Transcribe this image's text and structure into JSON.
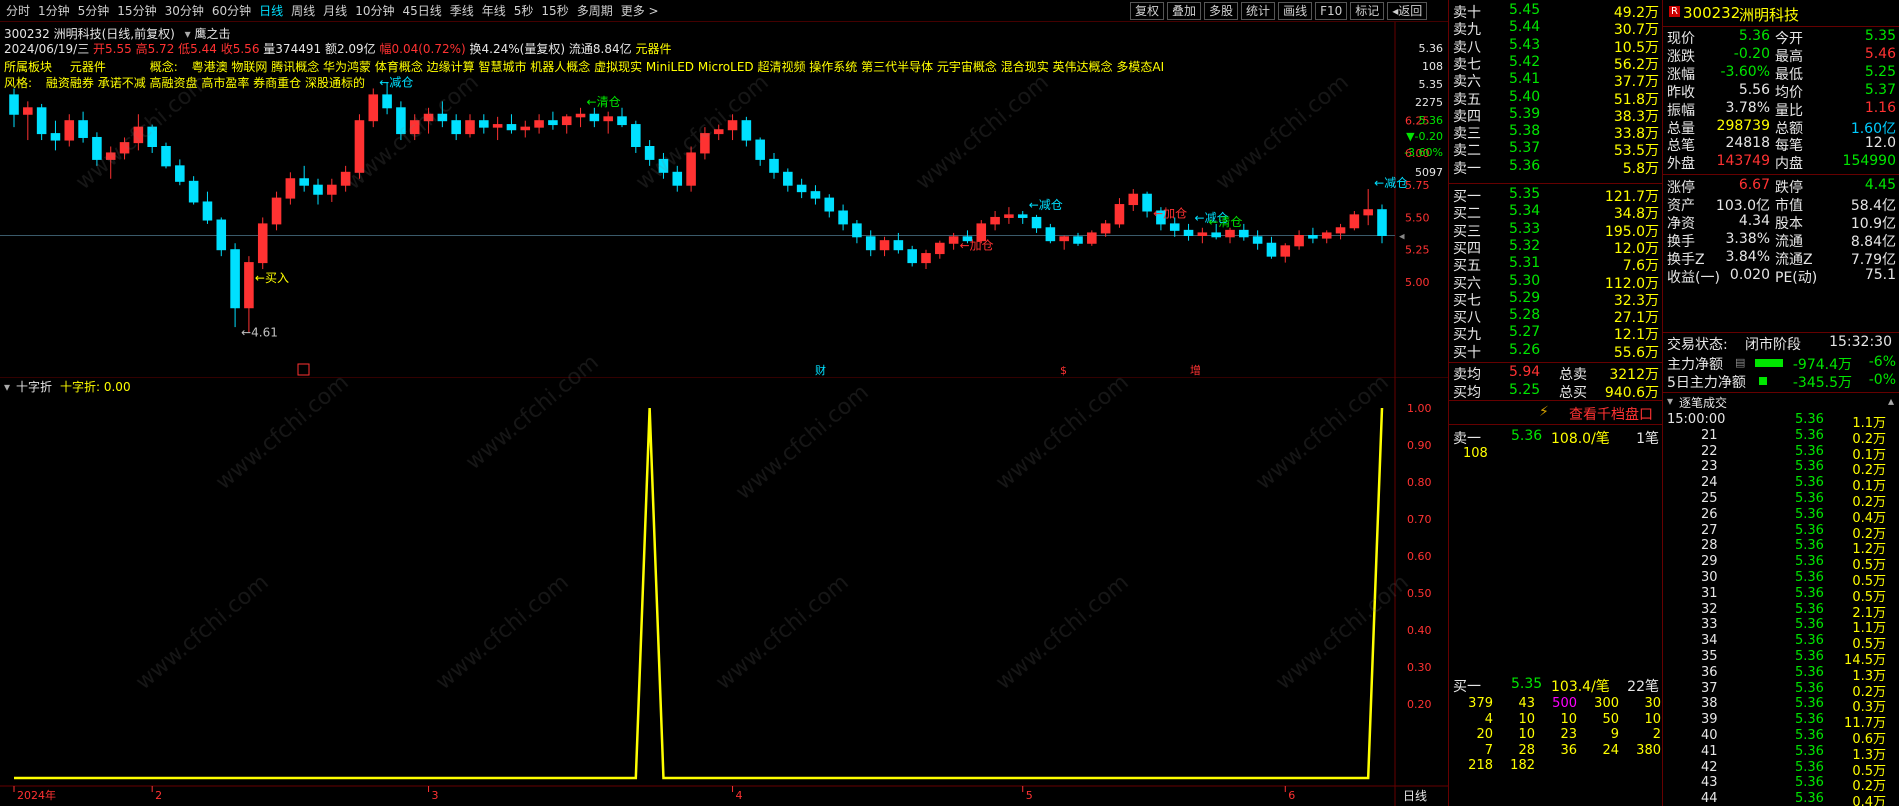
{
  "toolbar": {
    "timeframes": [
      "分时",
      "1分钟",
      "5分钟",
      "15分钟",
      "30分钟",
      "60分钟",
      "日线",
      "周线",
      "月线",
      "10分钟",
      "45日线",
      "季线",
      "年线",
      "5秒",
      "15秒",
      "多周期",
      "更多 >"
    ],
    "active_timeframe": "日线",
    "buttons": [
      "复权",
      "叠加",
      "多股",
      "统计",
      "画线",
      "F10",
      "标记",
      "◂返回"
    ]
  },
  "chart_header": {
    "title": "300232 洲明科技(日线,前复权)",
    "indicator": "鹰之击",
    "info_date": "2024/06/19/三",
    "info_open": "开5.55",
    "info_high": "高5.72",
    "info_low": "低5.44",
    "info_close": "收5.56",
    "info_vol": "量374491",
    "info_amt": "额2.09亿",
    "info_chg": "幅0.04(0.72%)",
    "info_turn": "换4.24%(量复权)",
    "info_float": "流通8.84亿",
    "info_sector": "元器件",
    "sector_label": "所属板块",
    "sector_value": "元器件",
    "concept_label": "概念:",
    "concepts": "粤港澳 物联网 腾讯概念 华为鸿蒙 体育概念 边缘计算 智慧城市 机器人概念 虚拟现实 MiniLED MicroLED 超清视频 操作系统 第三代半导体 元宇宙概念 混合现实 英伟达概念 多模态AI",
    "style_label": "风格:",
    "styles": "融资融券 承诺不减 高融资盘 高市盈率 券商重仓 深股通标的"
  },
  "annotations": [
    {
      "text": "←减仓",
      "color": "#00e0ff"
    },
    {
      "text": "←清仓",
      "color": "#00e600"
    },
    {
      "text": "←买入",
      "color": "#ffff00"
    },
    {
      "text": "←4.61",
      "color": "#c0c0c0"
    },
    {
      "text": "←加仓",
      "color": "#ff3232"
    },
    {
      "text": "←减仓",
      "color": "#00e0ff"
    },
    {
      "text": "←减仓",
      "color": "#00e0ff"
    },
    {
      "text": "←清仓",
      "color": "#00e600"
    },
    {
      "text": "←加仓",
      "color": "#ff3232"
    },
    {
      "text": "←减仓",
      "color": "#00e0ff"
    }
  ],
  "markers": [
    "财",
    "$",
    "增"
  ],
  "price_axis": [
    "6.25",
    "6.00",
    "5.75",
    "5.50",
    "5.25",
    "5.00"
  ],
  "price_axis_info": [
    "5.36",
    "108",
    "5.35",
    "2275",
    "5.36",
    "▼-0.20",
    "-3.60%",
    "5097"
  ],
  "indicator_panel": {
    "name": "十字折",
    "value_label": "十字折: 0.00",
    "axis": [
      "1.00",
      "0.90",
      "0.80",
      "0.70",
      "0.60",
      "0.50",
      "0.40",
      "0.30",
      "0.20"
    ]
  },
  "x_axis": [
    "2024年",
    "2",
    "3",
    "4",
    "5",
    "6"
  ],
  "period_label": "日线",
  "chart_data": {
    "type": "candlestick",
    "ylim": [
      4.55,
      6.55
    ],
    "ohlc": [
      [
        6.45,
        6.5,
        6.2,
        6.3
      ],
      [
        6.3,
        6.4,
        6.1,
        6.35
      ],
      [
        6.35,
        6.38,
        6.1,
        6.15
      ],
      [
        6.15,
        6.25,
        6.02,
        6.1
      ],
      [
        6.1,
        6.3,
        6.05,
        6.25
      ],
      [
        6.25,
        6.32,
        6.08,
        6.12
      ],
      [
        6.12,
        6.16,
        5.9,
        5.95
      ],
      [
        5.95,
        6.05,
        5.8,
        6.0
      ],
      [
        6.0,
        6.12,
        5.95,
        6.08
      ],
      [
        6.08,
        6.3,
        6.02,
        6.2
      ],
      [
        6.2,
        6.22,
        6.0,
        6.05
      ],
      [
        6.05,
        6.08,
        5.88,
        5.9
      ],
      [
        5.9,
        5.95,
        5.75,
        5.78
      ],
      [
        5.78,
        5.82,
        5.6,
        5.62
      ],
      [
        5.62,
        5.7,
        5.45,
        5.48
      ],
      [
        5.48,
        5.5,
        5.2,
        5.25
      ],
      [
        5.25,
        5.3,
        4.65,
        4.8
      ],
      [
        4.8,
        5.2,
        4.61,
        5.15
      ],
      [
        5.15,
        5.5,
        5.1,
        5.45
      ],
      [
        5.45,
        5.7,
        5.4,
        5.65
      ],
      [
        5.65,
        5.85,
        5.6,
        5.8
      ],
      [
        5.8,
        5.9,
        5.7,
        5.75
      ],
      [
        5.75,
        5.8,
        5.6,
        5.68
      ],
      [
        5.68,
        5.8,
        5.62,
        5.75
      ],
      [
        5.75,
        5.9,
        5.7,
        5.85
      ],
      [
        5.85,
        6.3,
        5.8,
        6.25
      ],
      [
        6.25,
        6.5,
        6.2,
        6.45
      ],
      [
        6.45,
        6.55,
        6.3,
        6.35
      ],
      [
        6.35,
        6.4,
        6.1,
        6.15
      ],
      [
        6.15,
        6.3,
        6.1,
        6.25
      ],
      [
        6.25,
        6.35,
        6.15,
        6.3
      ],
      [
        6.3,
        6.4,
        6.2,
        6.25
      ],
      [
        6.25,
        6.3,
        6.1,
        6.15
      ],
      [
        6.15,
        6.3,
        6.12,
        6.25
      ],
      [
        6.25,
        6.3,
        6.15,
        6.2
      ],
      [
        6.2,
        6.28,
        6.1,
        6.22
      ],
      [
        6.22,
        6.3,
        6.15,
        6.18
      ],
      [
        6.18,
        6.25,
        6.12,
        6.2
      ],
      [
        6.2,
        6.3,
        6.15,
        6.25
      ],
      [
        6.25,
        6.32,
        6.18,
        6.22
      ],
      [
        6.22,
        6.3,
        6.15,
        6.28
      ],
      [
        6.28,
        6.35,
        6.2,
        6.3
      ],
      [
        6.3,
        6.35,
        6.2,
        6.25
      ],
      [
        6.25,
        6.32,
        6.15,
        6.28
      ],
      [
        6.28,
        6.35,
        6.2,
        6.22
      ],
      [
        6.22,
        6.25,
        6.0,
        6.05
      ],
      [
        6.05,
        6.1,
        5.9,
        5.95
      ],
      [
        5.95,
        6.0,
        5.8,
        5.85
      ],
      [
        5.85,
        5.9,
        5.7,
        5.75
      ],
      [
        5.75,
        6.05,
        5.7,
        6.0
      ],
      [
        6.0,
        6.2,
        5.95,
        6.15
      ],
      [
        6.15,
        6.22,
        6.1,
        6.18
      ],
      [
        6.18,
        6.3,
        6.1,
        6.25
      ],
      [
        6.25,
        6.28,
        6.05,
        6.1
      ],
      [
        6.1,
        6.12,
        5.9,
        5.95
      ],
      [
        5.95,
        6.0,
        5.8,
        5.85
      ],
      [
        5.85,
        5.88,
        5.7,
        5.75
      ],
      [
        5.75,
        5.8,
        5.65,
        5.7
      ],
      [
        5.7,
        5.75,
        5.6,
        5.65
      ],
      [
        5.65,
        5.68,
        5.5,
        5.55
      ],
      [
        5.55,
        5.6,
        5.4,
        5.45
      ],
      [
        5.45,
        5.48,
        5.3,
        5.35
      ],
      [
        5.35,
        5.4,
        5.2,
        5.25
      ],
      [
        5.25,
        5.35,
        5.2,
        5.32
      ],
      [
        5.32,
        5.38,
        5.22,
        5.25
      ],
      [
        5.25,
        5.28,
        5.12,
        5.15
      ],
      [
        5.15,
        5.25,
        5.1,
        5.22
      ],
      [
        5.22,
        5.32,
        5.18,
        5.3
      ],
      [
        5.3,
        5.38,
        5.25,
        5.35
      ],
      [
        5.35,
        5.4,
        5.3,
        5.32
      ],
      [
        5.32,
        5.48,
        5.3,
        5.45
      ],
      [
        5.45,
        5.55,
        5.4,
        5.5
      ],
      [
        5.5,
        5.58,
        5.45,
        5.52
      ],
      [
        5.52,
        5.55,
        5.45,
        5.5
      ],
      [
        5.5,
        5.52,
        5.38,
        5.42
      ],
      [
        5.42,
        5.45,
        5.3,
        5.32
      ],
      [
        5.32,
        5.36,
        5.25,
        5.35
      ],
      [
        5.35,
        5.38,
        5.28,
        5.3
      ],
      [
        5.3,
        5.4,
        5.28,
        5.38
      ],
      [
        5.38,
        5.48,
        5.35,
        5.45
      ],
      [
        5.45,
        5.65,
        5.42,
        5.6
      ],
      [
        5.6,
        5.72,
        5.55,
        5.68
      ],
      [
        5.68,
        5.7,
        5.5,
        5.55
      ],
      [
        5.55,
        5.58,
        5.4,
        5.45
      ],
      [
        5.45,
        5.5,
        5.35,
        5.4
      ],
      [
        5.4,
        5.45,
        5.32,
        5.36
      ],
      [
        5.36,
        5.42,
        5.3,
        5.38
      ],
      [
        5.38,
        5.45,
        5.33,
        5.35
      ],
      [
        5.35,
        5.42,
        5.3,
        5.4
      ],
      [
        5.4,
        5.45,
        5.32,
        5.35
      ],
      [
        5.35,
        5.4,
        5.25,
        5.3
      ],
      [
        5.3,
        5.35,
        5.18,
        5.2
      ],
      [
        5.2,
        5.3,
        5.15,
        5.28
      ],
      [
        5.28,
        5.4,
        5.25,
        5.36
      ],
      [
        5.36,
        5.42,
        5.3,
        5.34
      ],
      [
        5.34,
        5.4,
        5.3,
        5.38
      ],
      [
        5.38,
        5.45,
        5.33,
        5.42
      ],
      [
        5.42,
        5.55,
        5.4,
        5.52
      ],
      [
        5.52,
        5.72,
        5.44,
        5.56
      ],
      [
        5.56,
        5.6,
        5.3,
        5.36
      ]
    ],
    "indicator_values_spikes": [
      {
        "index": 46,
        "value": 1.0
      },
      {
        "index": 99,
        "value": 1.0
      }
    ]
  },
  "order_book": {
    "sell": [
      {
        "label": "卖十",
        "price": "5.45",
        "vol": "49.2万"
      },
      {
        "label": "卖九",
        "price": "5.44",
        "vol": "30.7万"
      },
      {
        "label": "卖八",
        "price": "5.43",
        "vol": "10.5万"
      },
      {
        "label": "卖七",
        "price": "5.42",
        "vol": "56.2万"
      },
      {
        "label": "卖六",
        "price": "5.41",
        "vol": "37.7万"
      },
      {
        "label": "卖五",
        "price": "5.40",
        "vol": "51.8万"
      },
      {
        "label": "卖四",
        "price": "5.39",
        "vol": "38.3万"
      },
      {
        "label": "卖三",
        "price": "5.38",
        "vol": "33.8万"
      },
      {
        "label": "卖二",
        "price": "5.37",
        "vol": "53.5万"
      },
      {
        "label": "卖一",
        "price": "5.36",
        "vol": "5.8万"
      }
    ],
    "buy": [
      {
        "label": "买一",
        "price": "5.35",
        "vol": "121.7万"
      },
      {
        "label": "买二",
        "price": "5.34",
        "vol": "34.8万"
      },
      {
        "label": "买三",
        "price": "5.33",
        "vol": "195.0万"
      },
      {
        "label": "买四",
        "price": "5.32",
        "vol": "12.0万"
      },
      {
        "label": "买五",
        "price": "5.31",
        "vol": "7.6万"
      },
      {
        "label": "买六",
        "price": "5.30",
        "vol": "112.0万"
      },
      {
        "label": "买七",
        "price": "5.29",
        "vol": "32.3万"
      },
      {
        "label": "买八",
        "price": "5.28",
        "vol": "27.1万"
      },
      {
        "label": "买九",
        "price": "5.27",
        "vol": "12.1万"
      },
      {
        "label": "买十",
        "price": "5.26",
        "vol": "55.6万"
      }
    ],
    "avg_sell_label": "卖均",
    "avg_sell": "5.94",
    "total_sell_label": "总卖",
    "total_sell": "3212万",
    "avg_buy_label": "买均",
    "avg_buy": "5.25",
    "total_buy_label": "总买",
    "total_buy": "940.6万",
    "view_depth": "查看千档盘口",
    "sell1_detail": {
      "label": "卖一",
      "price": "5.36",
      "per": "108.0/笔",
      "count": "1笔",
      "orders": [
        "108"
      ]
    },
    "buy1_detail": {
      "label": "买一",
      "price": "5.35",
      "per": "103.4/笔",
      "count": "22笔",
      "orders": [
        [
          "379",
          "43",
          "500",
          "300",
          "30"
        ],
        [
          "4",
          "10",
          "10",
          "50",
          "10"
        ],
        [
          "20",
          "10",
          "23",
          "9",
          "2"
        ],
        [
          "7",
          "28",
          "36",
          "24",
          "380"
        ],
        [
          "218",
          "182",
          "",
          "",
          ""
        ]
      ]
    }
  },
  "quote": {
    "code": "300232",
    "name": "洲明科技",
    "tag": "R",
    "rows": [
      [
        "现价",
        "5.36",
        "今开",
        "5.35"
      ],
      [
        "涨跌",
        "-0.20",
        "最高",
        "5.46"
      ],
      [
        "涨幅",
        "-3.60%",
        "最低",
        "5.25"
      ],
      [
        "昨收",
        "5.56",
        "均价",
        "5.37"
      ],
      [
        "振幅",
        "3.78%",
        "量比",
        "1.16"
      ],
      [
        "总量",
        "298739",
        "总额",
        "1.60亿"
      ],
      [
        "总笔",
        "24818",
        "每笔",
        "12.0"
      ],
      [
        "外盘",
        "143749",
        "内盘",
        "154990"
      ],
      [
        "涨停",
        "6.67",
        "跌停",
        "4.45"
      ],
      [
        "资产",
        "103.0亿",
        "市值",
        "58.4亿"
      ],
      [
        "净资",
        "4.34",
        "股本",
        "10.9亿"
      ],
      [
        "换手",
        "3.38%",
        "流通",
        "8.84亿"
      ],
      [
        "换手Z",
        "3.84%",
        "流通Z",
        "7.79亿"
      ],
      [
        "收益(一)",
        "0.020",
        "PE(动)",
        "75.1"
      ]
    ],
    "trade_status_label": "交易状态:",
    "trade_status": "闭市阶段",
    "trade_time": "15:32:30",
    "mainflow_label": "主力净额",
    "mainflow": "-974.4万",
    "mainflow_pct": "-6%",
    "mainflow5_label": "5日主力净额",
    "mainflow5": "-345.5万",
    "mainflow5_pct": "-0%",
    "ticks_title": "逐笔成交",
    "ticks": [
      [
        "15:00:00",
        "5.36",
        "1.1万"
      ],
      [
        "21",
        "5.36",
        "0.2万"
      ],
      [
        "22",
        "5.36",
        "0.1万"
      ],
      [
        "23",
        "5.36",
        "0.2万"
      ],
      [
        "24",
        "5.36",
        "0.1万"
      ],
      [
        "25",
        "5.36",
        "0.2万"
      ],
      [
        "26",
        "5.36",
        "0.4万"
      ],
      [
        "27",
        "5.36",
        "0.2万"
      ],
      [
        "28",
        "5.36",
        "1.2万"
      ],
      [
        "29",
        "5.36",
        "0.5万"
      ],
      [
        "30",
        "5.36",
        "0.5万"
      ],
      [
        "31",
        "5.36",
        "0.5万"
      ],
      [
        "32",
        "5.36",
        "2.1万"
      ],
      [
        "33",
        "5.36",
        "1.1万"
      ],
      [
        "34",
        "5.36",
        "0.5万"
      ],
      [
        "35",
        "5.36",
        "14.5万"
      ],
      [
        "36",
        "5.36",
        "1.3万"
      ],
      [
        "37",
        "5.36",
        "0.2万"
      ],
      [
        "38",
        "5.36",
        "0.3万"
      ],
      [
        "39",
        "5.36",
        "11.7万"
      ],
      [
        "40",
        "5.36",
        "0.6万"
      ],
      [
        "41",
        "5.36",
        "1.3万"
      ],
      [
        "42",
        "5.36",
        "0.5万"
      ],
      [
        "43",
        "5.36",
        "0.2万"
      ],
      [
        "44",
        "5.36",
        "0.4万"
      ]
    ]
  },
  "watermark": "www.cfchi.com"
}
